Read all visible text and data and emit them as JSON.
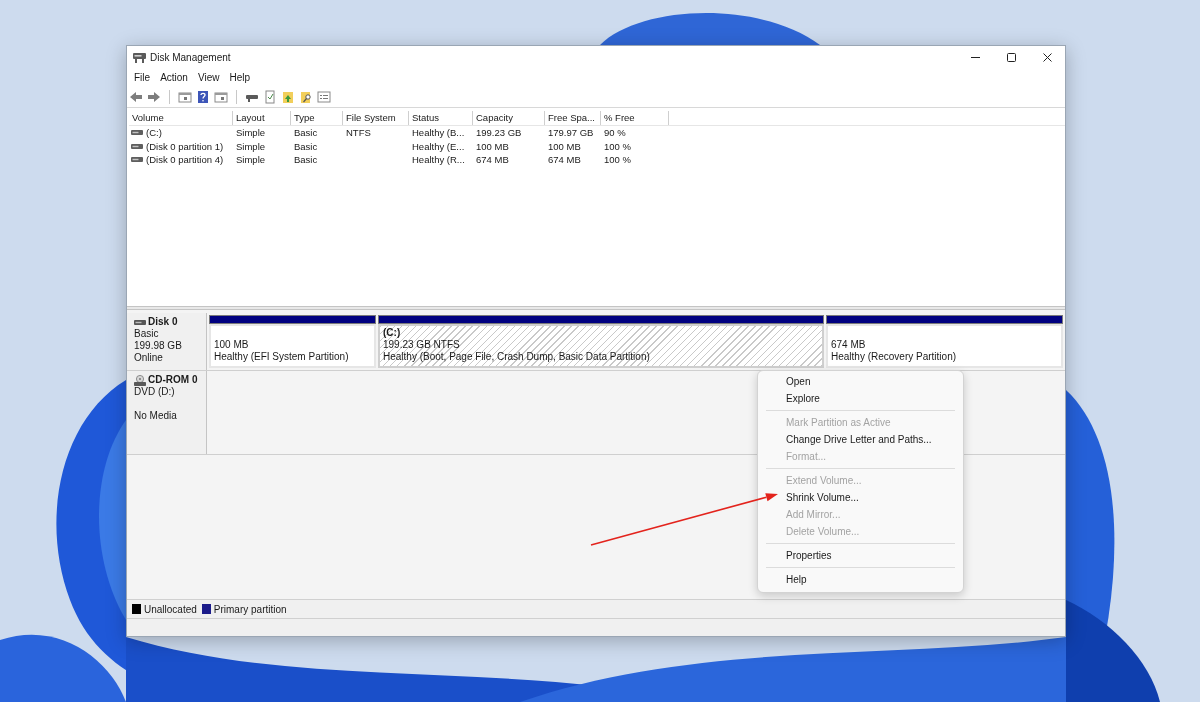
{
  "window": {
    "title": "Disk Management"
  },
  "menu_bar": [
    {
      "label": "File"
    },
    {
      "label": "Action"
    },
    {
      "label": "View"
    },
    {
      "label": "Help"
    }
  ],
  "volume_table": {
    "columns": [
      "Volume",
      "Layout",
      "Type",
      "File System",
      "Status",
      "Capacity",
      "Free Spa...",
      "% Free"
    ],
    "rows": [
      {
        "cells": [
          "(C:)",
          "Simple",
          "Basic",
          "NTFS",
          "Healthy (B...",
          "199.23 GB",
          "179.97 GB",
          "90 %"
        ]
      },
      {
        "cells": [
          "(Disk 0 partition 1)",
          "Simple",
          "Basic",
          "",
          "Healthy (E...",
          "100 MB",
          "100 MB",
          "100 %"
        ]
      },
      {
        "cells": [
          "(Disk 0 partition 4)",
          "Simple",
          "Basic",
          "",
          "Healthy (R...",
          "674 MB",
          "674 MB",
          "100 %"
        ]
      }
    ]
  },
  "disks": [
    {
      "kind": "hdd",
      "name": "Disk 0",
      "type": "Basic",
      "size": "199.98 GB",
      "status": "Online",
      "partitions": [
        {
          "size": "100 MB",
          "status": "Healthy (EFI System Partition)",
          "selected": false
        },
        {
          "label": "(C:)",
          "size": "199.23 GB NTFS",
          "status": "Healthy (Boot, Page File, Crash Dump, Basic Data Partition)",
          "selected": true
        },
        {
          "size": "674 MB",
          "status": "Healthy (Recovery Partition)",
          "selected": false
        }
      ]
    },
    {
      "kind": "cdrom",
      "name": "CD-ROM 0",
      "type": "DVD (D:)",
      "status": "No Media"
    }
  ],
  "legend": [
    {
      "label": "Unallocated",
      "color": "#000000"
    },
    {
      "label": "Primary partition",
      "color": "#1c1c8a"
    }
  ],
  "context_menu": {
    "items": [
      {
        "kind": "item",
        "label": "Open",
        "disabled": false
      },
      {
        "kind": "item",
        "label": "Explore",
        "disabled": false
      },
      {
        "kind": "separator"
      },
      {
        "kind": "item",
        "label": "Mark Partition as Active",
        "disabled": true
      },
      {
        "kind": "item",
        "label": "Change Drive Letter and Paths...",
        "disabled": false
      },
      {
        "kind": "item",
        "label": "Format...",
        "disabled": true
      },
      {
        "kind": "separator"
      },
      {
        "kind": "item",
        "label": "Extend Volume...",
        "disabled": true
      },
      {
        "kind": "item",
        "label": "Shrink Volume...",
        "disabled": false
      },
      {
        "kind": "item",
        "label": "Add Mirror...",
        "disabled": true
      },
      {
        "kind": "item",
        "label": "Delete Volume...",
        "disabled": true
      },
      {
        "kind": "separator"
      },
      {
        "kind": "item",
        "label": "Properties",
        "disabled": false
      },
      {
        "kind": "separator"
      },
      {
        "kind": "item",
        "label": "Help",
        "disabled": false
      }
    ]
  }
}
